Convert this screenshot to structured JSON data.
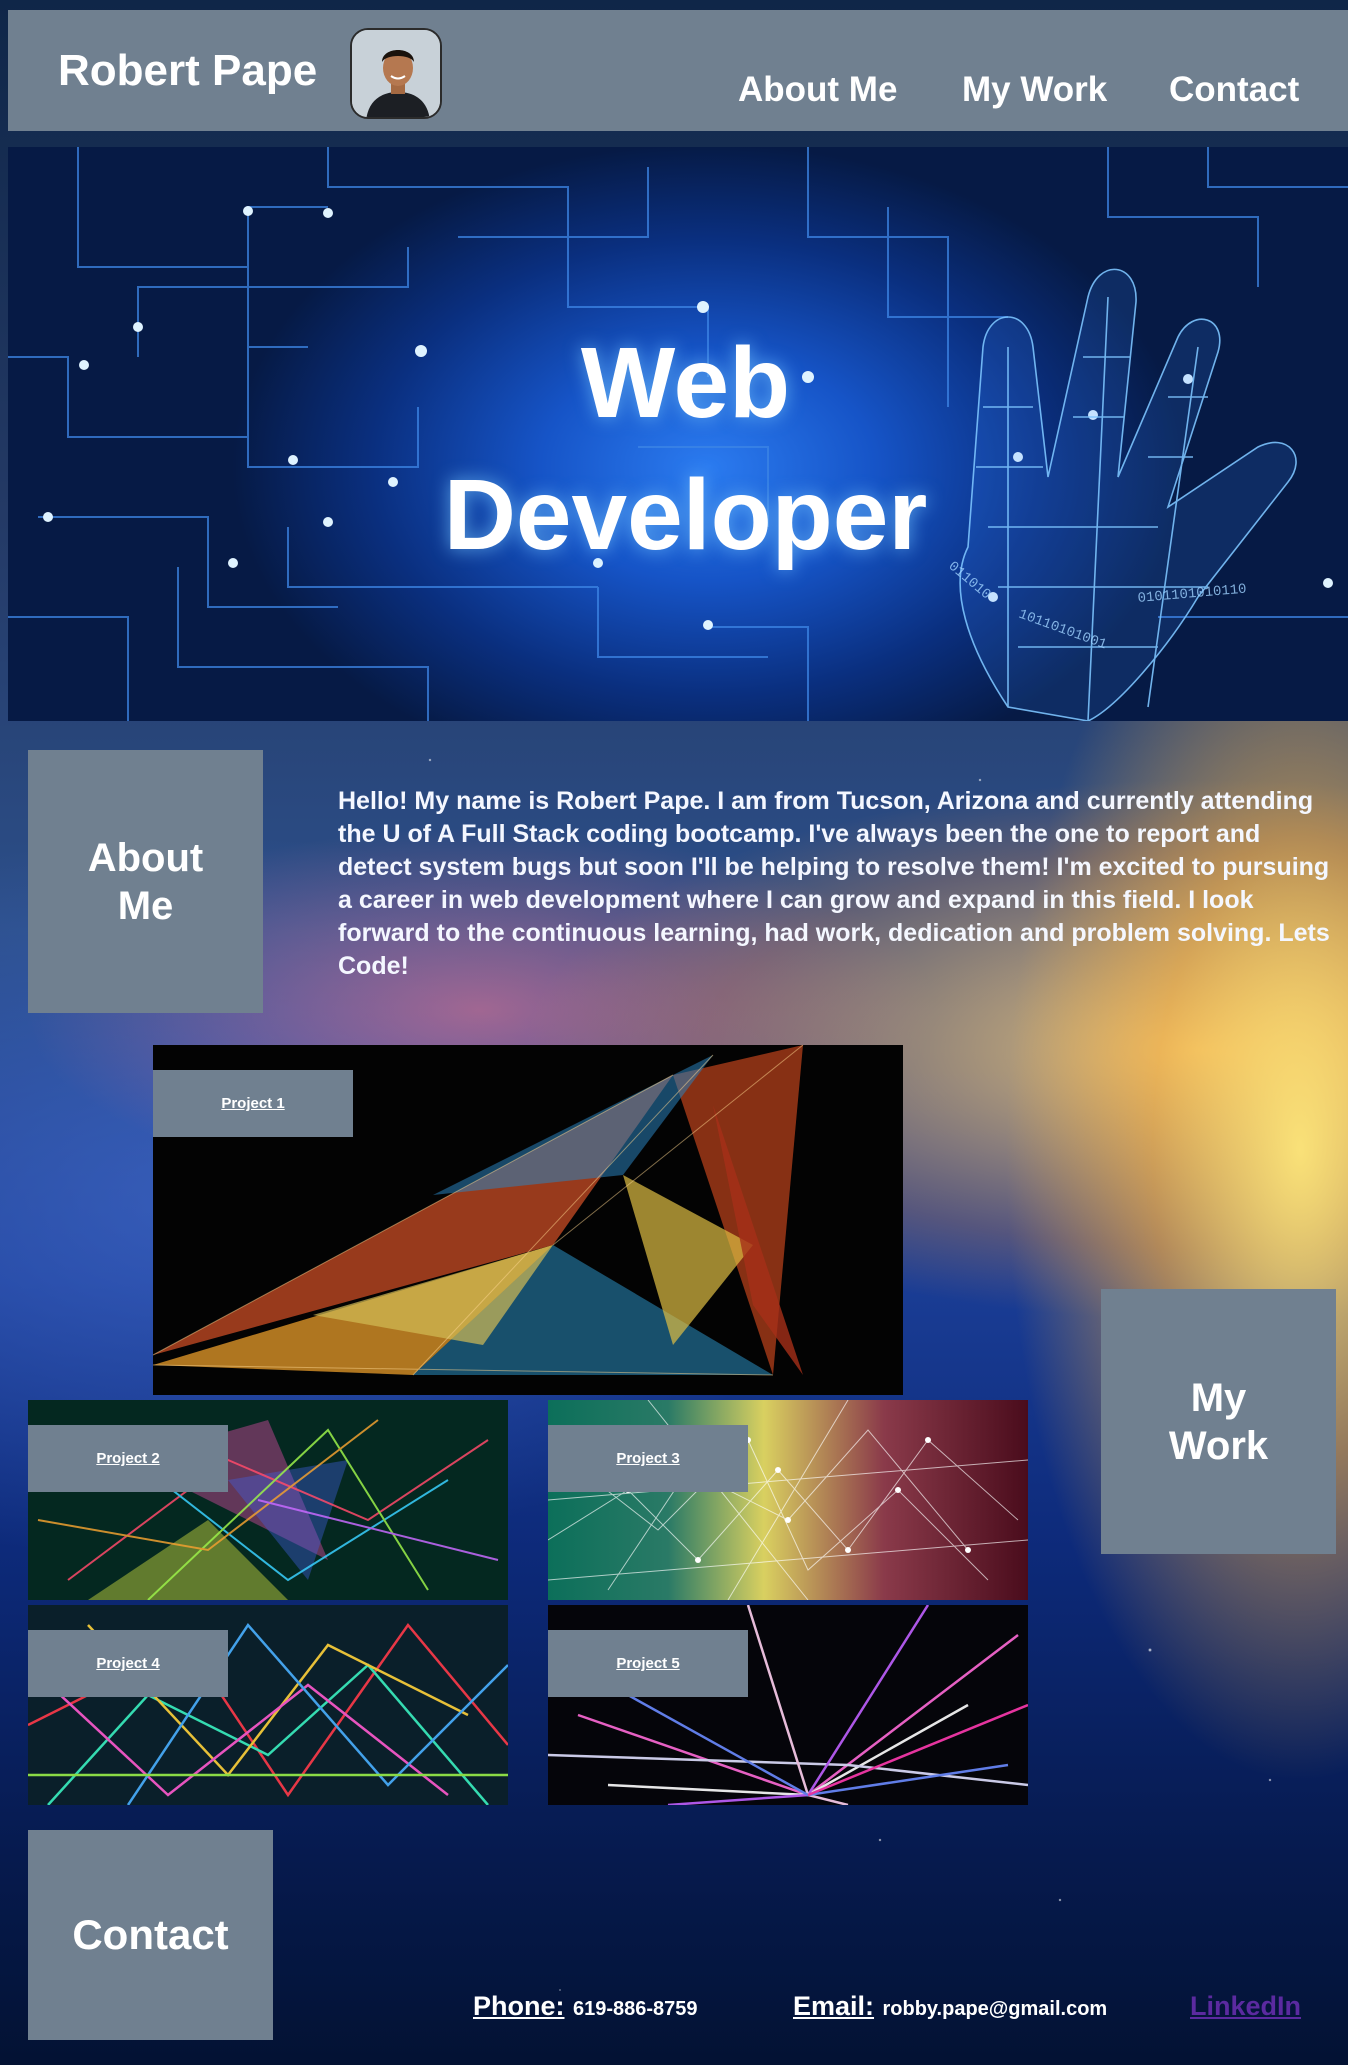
{
  "header": {
    "name": "Robert Pape",
    "nav": {
      "about": "About Me",
      "work": "My Work",
      "contact": "Contact"
    }
  },
  "hero": {
    "title_line1": "Web",
    "title_line2": "Developer"
  },
  "about": {
    "heading_line1": "About",
    "heading_line2": "Me",
    "text": "Hello! My name is Robert Pape. I am from Tucson, Arizona and currently attending the U of A Full Stack coding bootcamp. I've always been the one to report and detect system bugs but soon I'll be helping to resolve them! I'm excited to pursuing a career in web development where I can grow and expand in this field. I look forward to the continuous learning, had work, dedication and problem solving. Lets Code!"
  },
  "work": {
    "heading_line1": "My",
    "heading_line2": "Work",
    "projects": [
      "Project 1",
      "Project 2",
      "Project 3",
      "Project 4",
      "Project 5"
    ]
  },
  "contact": {
    "heading": "Contact",
    "phone_label": "Phone:",
    "phone_value": "619-886-8759",
    "email_label": "Email:",
    "email_value": "robby.pape@gmail.com",
    "linkedin": "LinkedIn"
  },
  "colors": {
    "panel": "#708090",
    "linkedin": "#5b2aa0"
  }
}
